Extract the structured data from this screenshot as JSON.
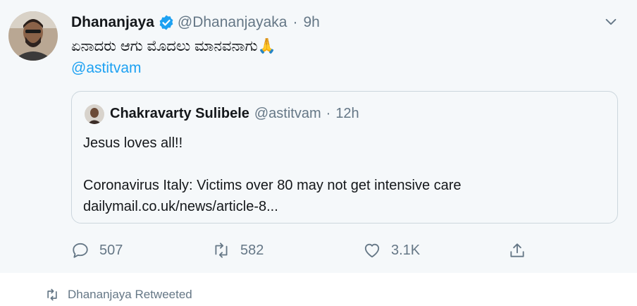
{
  "tweet": {
    "author_name": "Dhananjaya",
    "author_handle": "@Dhananjayaka",
    "separator": "·",
    "time": "9h",
    "text": "ಏನಾದರು ಆಗು ಮೊದಲು ಮಾನವನಾಗು🙏",
    "mention": "@astitvam",
    "avatar_icon": "profile-photo",
    "verified_icon": "verified-badge",
    "verified_color": "#1da1f2",
    "menu_icon": "chevron-down"
  },
  "quoted_tweet": {
    "author_name": "Chakravarty Sulibele",
    "author_handle": "@astitvam",
    "separator": "·",
    "time": "12h",
    "lines": [
      "Jesus loves all!!",
      "",
      "Coronavirus Italy: Victims over 80 may not get intensive care",
      "dailymail.co.uk/news/article-8..."
    ]
  },
  "actions": {
    "reply_count": "507",
    "retweet_count": "582",
    "like_count": "3.1K",
    "share_icon": "share"
  },
  "retweet_banner": {
    "text": "Dhananjaya Retweeted"
  },
  "colors": {
    "background": "#f5f8fa",
    "accent": "#1da1f2",
    "secondary_text": "#657786"
  }
}
